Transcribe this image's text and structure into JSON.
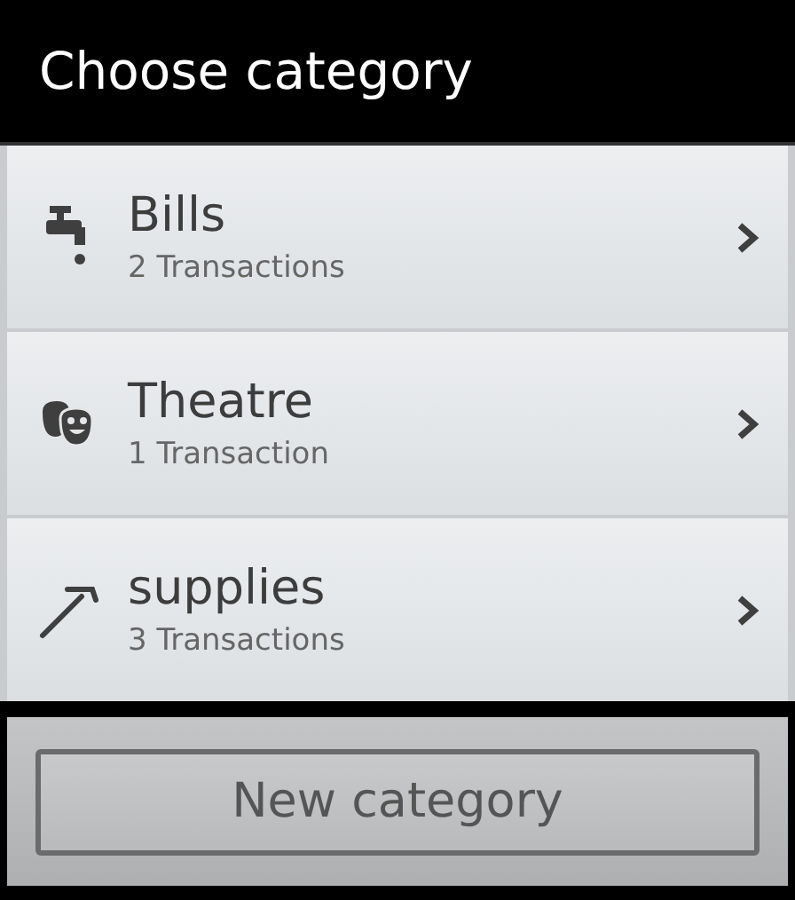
{
  "dialog": {
    "title": "Choose category"
  },
  "categories": [
    {
      "name": "Bills",
      "count": "2 Transactions"
    },
    {
      "name": "Theatre",
      "count": "1 Transaction"
    },
    {
      "name": "supplies",
      "count": "3 Transactions"
    }
  ],
  "button": "New category"
}
